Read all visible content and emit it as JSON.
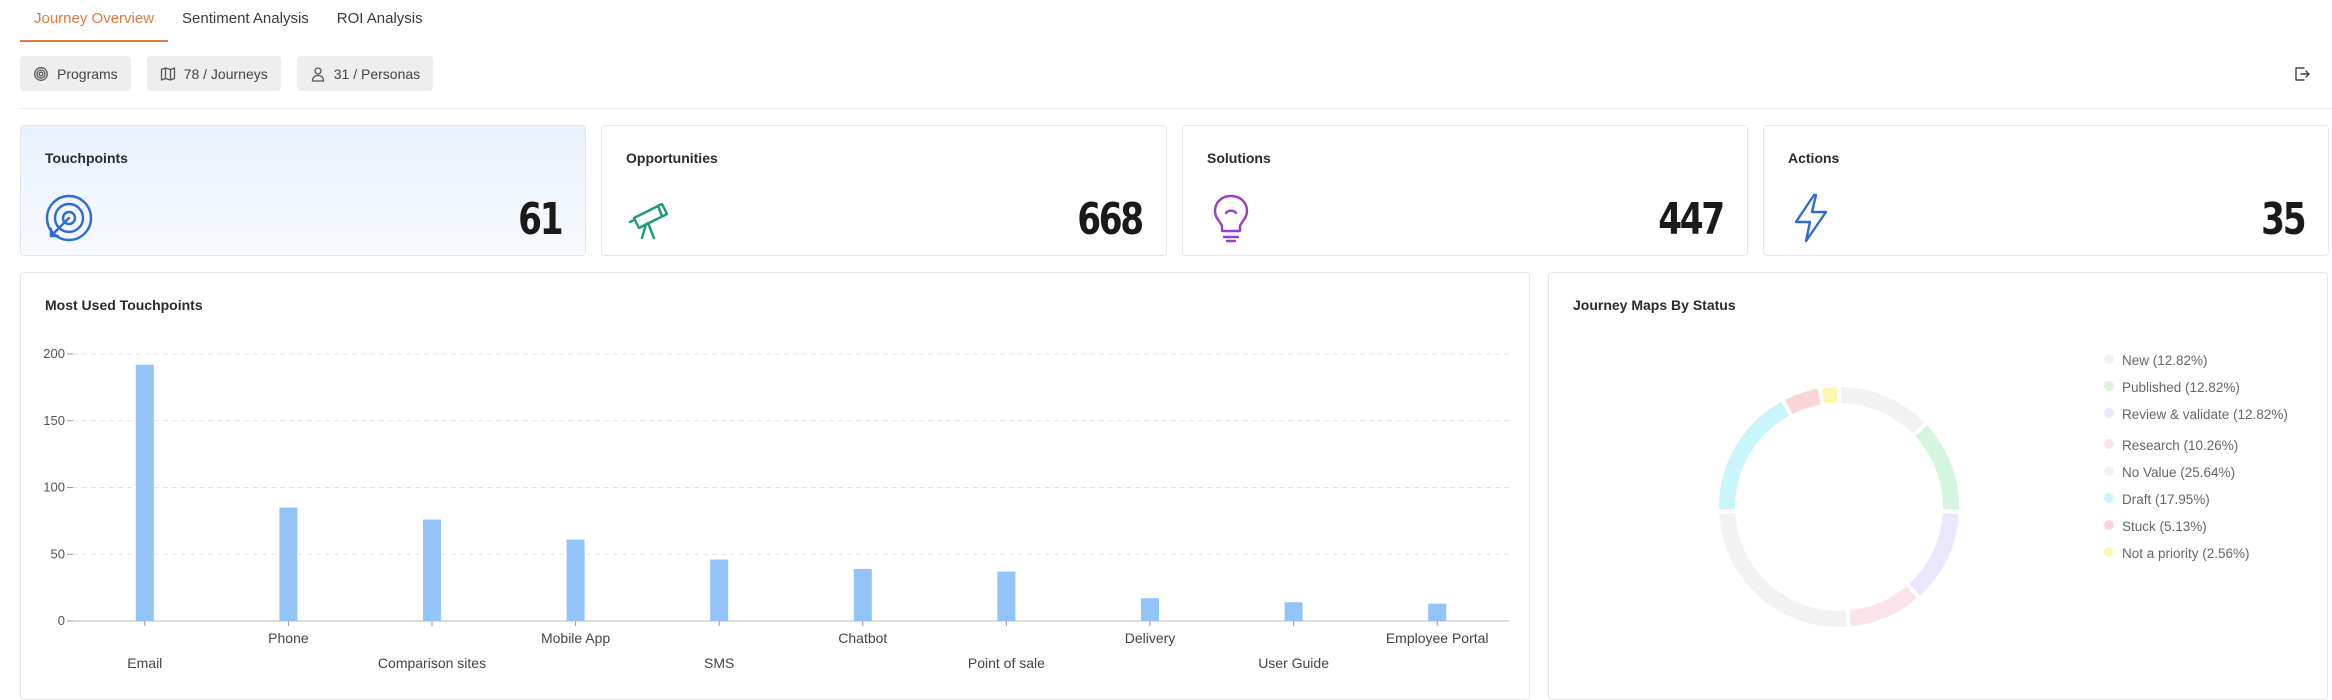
{
  "tabs": [
    {
      "label": "Journey Overview",
      "active": true
    },
    {
      "label": "Sentiment Analysis",
      "active": false
    },
    {
      "label": "ROI Analysis",
      "active": false
    }
  ],
  "filters": {
    "programs": "Programs",
    "journeys": "78 / Journeys",
    "personas": "31 / Personas"
  },
  "stats": [
    {
      "title": "Touchpoints",
      "value": "61",
      "icon": "target-icon",
      "color": "#2e6bd3"
    },
    {
      "title": "Opportunities",
      "value": "668",
      "icon": "telescope-icon",
      "color": "#1a9c7c"
    },
    {
      "title": "Solutions",
      "value": "447",
      "icon": "lightbulb-icon",
      "color": "#9a3fc5"
    },
    {
      "title": "Actions",
      "value": "35",
      "icon": "lightning-icon",
      "color": "#2e6bd3"
    }
  ],
  "bar_panel": {
    "title": "Most Used Touchpoints"
  },
  "donut_panel": {
    "title": "Journey Maps By Status"
  },
  "chart_data": [
    {
      "type": "bar",
      "title": "Most Used Touchpoints",
      "categories": [
        "Email",
        "Phone",
        "Comparison sites",
        "Mobile App",
        "SMS",
        "Chatbot",
        "Point of sale",
        "Delivery",
        "User Guide",
        "Employee Portal"
      ],
      "values": [
        192,
        85,
        76,
        61,
        46,
        39,
        37,
        17,
        14,
        13
      ],
      "ylim": [
        0,
        200
      ],
      "yticks": [
        "0",
        "50",
        "100",
        "150",
        "200"
      ],
      "grid": true,
      "bar_color": "#93c3f8"
    },
    {
      "type": "pie",
      "title": "Journey Maps By Status",
      "legend_position": "right",
      "slices": [
        {
          "label": "New (12.82%)",
          "value": 12.82,
          "color": "#f2f2f2"
        },
        {
          "label": "Published (12.82%)",
          "value": 12.82,
          "color": "#d6f5de"
        },
        {
          "label": "Review & validate (12.82%)",
          "value": 12.82,
          "color": "#ebe6fc"
        },
        {
          "label": "Research (10.26%)",
          "value": 10.26,
          "color": "#fbe3ea"
        },
        {
          "label": "No Value (25.64%)",
          "value": 25.64,
          "color": "#f2f2f2"
        },
        {
          "label": "Draft (17.95%)",
          "value": 17.95,
          "color": "#c9f5fa"
        },
        {
          "label": "Stuck (5.13%)",
          "value": 5.13,
          "color": "#f9d4d8"
        },
        {
          "label": "Not a priority (2.56%)",
          "value": 2.56,
          "color": "#fbf7b3"
        }
      ]
    }
  ]
}
